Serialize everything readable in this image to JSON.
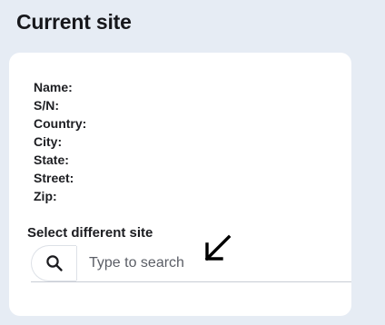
{
  "page": {
    "title": "Current site"
  },
  "site_info": {
    "rows": [
      {
        "label": "Name:",
        "value": ""
      },
      {
        "label": "S/N:",
        "value": ""
      },
      {
        "label": "Country:",
        "value": ""
      },
      {
        "label": "City:",
        "value": ""
      },
      {
        "label": "State:",
        "value": ""
      },
      {
        "label": "Street:",
        "value": ""
      },
      {
        "label": "Zip:",
        "value": ""
      }
    ]
  },
  "select_site": {
    "label": "Select different site",
    "search": {
      "icon": "search-icon",
      "placeholder": "Type to search",
      "value": ""
    }
  },
  "annotation": {
    "icon": "arrow-down-left-icon",
    "color": "#000000"
  },
  "colors": {
    "background": "#e6ecf4",
    "card": "#ffffff",
    "text": "#1b1b1f"
  }
}
